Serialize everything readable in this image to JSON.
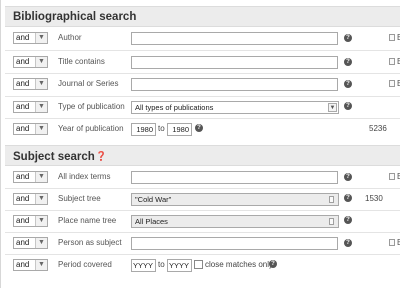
{
  "bibliographical": {
    "title": "Bibliographical search",
    "rows": [
      {
        "op": "and",
        "label": "Author",
        "browse": "B"
      },
      {
        "op": "and",
        "label": "Title contains",
        "browse": "B"
      },
      {
        "op": "and",
        "label": "Journal or Series",
        "browse": "B"
      },
      {
        "op": "and",
        "label": "Type of publication",
        "value": "All types of publications"
      },
      {
        "op": "and",
        "label": "Year of publication",
        "from": "1980",
        "to_label": "to",
        "to": "1980",
        "count": "5236"
      }
    ]
  },
  "subject": {
    "title": "Subject search",
    "rows": [
      {
        "op": "and",
        "label": "All index terms",
        "browse": "B"
      },
      {
        "op": "and",
        "label": "Subject tree",
        "value": "\"Cold War\"",
        "count": "1530"
      },
      {
        "op": "and",
        "label": "Place name tree",
        "value": "All Places"
      },
      {
        "op": "and",
        "label": "Person as subject",
        "browse": "B"
      },
      {
        "op": "and",
        "label": "Period covered",
        "from": "YYYY",
        "to_label": "to",
        "to": "YYYY",
        "checkbox_label": "close matches only"
      }
    ]
  },
  "icons": {
    "help": "?",
    "dropdown": "▼",
    "help_icon_name": "help-icon",
    "browse_icon_name": "browse-icon"
  }
}
